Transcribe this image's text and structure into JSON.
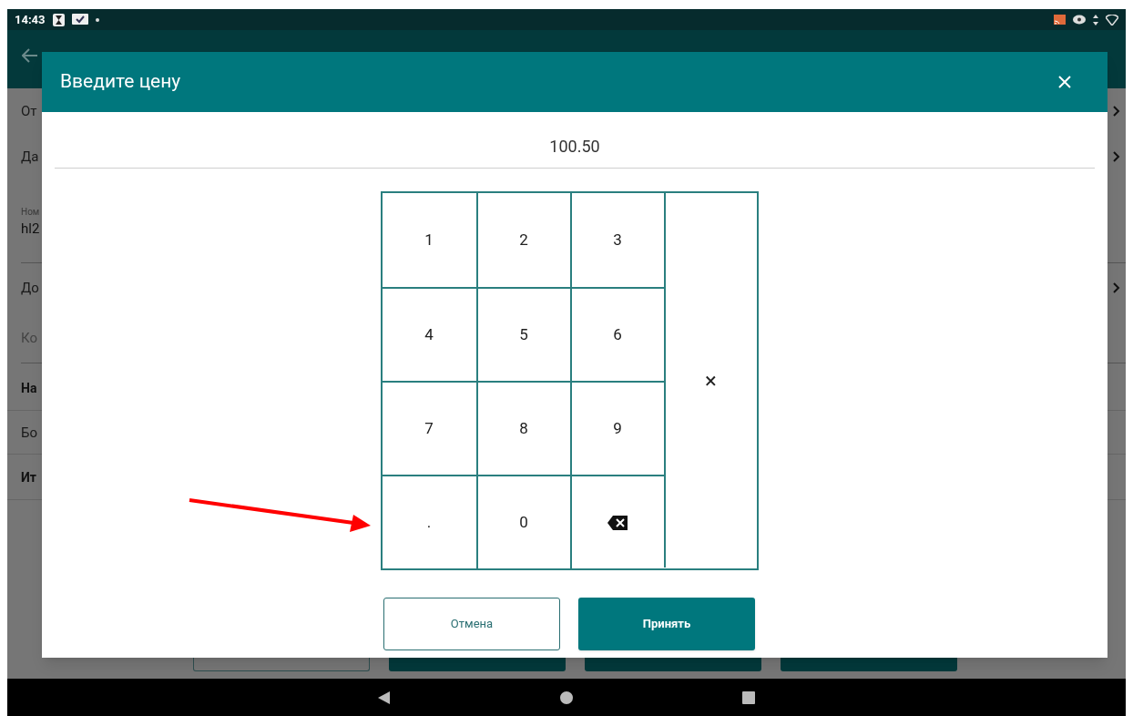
{
  "status_bar": {
    "time": "14:43"
  },
  "background": {
    "rows": [
      {
        "kind": "nav",
        "label": "От"
      },
      {
        "kind": "nav",
        "label": "Да"
      },
      {
        "kind": "field",
        "caption": "Ном",
        "label": "hl2"
      },
      {
        "kind": "nav",
        "label": "До"
      },
      {
        "kind": "input",
        "label": "Ко"
      },
      {
        "kind": "header",
        "label": "На"
      },
      {
        "kind": "item",
        "label": "Бо"
      },
      {
        "kind": "header",
        "label": "Ит"
      }
    ],
    "buttons": [
      {
        "kind": "outline"
      },
      {
        "kind": "filled"
      },
      {
        "kind": "filled"
      },
      {
        "kind": "filled"
      }
    ]
  },
  "dialog": {
    "title": "Введите цену",
    "value": "100.50",
    "keys": [
      {
        "kind": "digit",
        "label": "1"
      },
      {
        "kind": "digit",
        "label": "2"
      },
      {
        "kind": "digit",
        "label": "3"
      },
      {
        "kind": "digit",
        "label": "4"
      },
      {
        "kind": "digit",
        "label": "5"
      },
      {
        "kind": "digit",
        "label": "6"
      },
      {
        "kind": "digit",
        "label": "7"
      },
      {
        "kind": "digit",
        "label": "8"
      },
      {
        "kind": "digit",
        "label": "9"
      },
      {
        "kind": "digit",
        "label": "."
      },
      {
        "kind": "digit",
        "label": "0"
      },
      {
        "kind": "backspace"
      }
    ],
    "clear_key": "×",
    "buttons": [
      {
        "kind": "outline",
        "label": "Отмена"
      },
      {
        "kind": "filled",
        "label": "Принять"
      }
    ]
  }
}
